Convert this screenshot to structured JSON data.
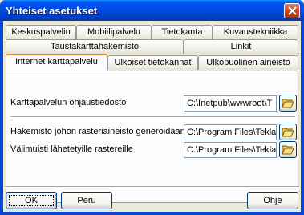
{
  "window": {
    "title": "Yhteiset asetukset",
    "close_icon": "close-icon"
  },
  "tabs": {
    "row1": [
      "Keskuspalvelin",
      "Mobiilipalvelu",
      "Tietokanta",
      "Kuvaustekniikka"
    ],
    "row2": [
      "Taustakarttahakemisto",
      "Linkit"
    ],
    "row3": [
      "Internet karttapalvelu",
      "Ulkoiset tietokannat",
      "Ulkopuolinen aineisto"
    ],
    "active": "Internet karttapalvelu"
  },
  "panel": {
    "field1": {
      "label": "Karttapalvelun ohjaustiedosto",
      "value": "C:\\Inetpub\\wwwroot\\T",
      "browse_icon": "open-folder-icon"
    },
    "field2": {
      "label": "Hakemisto johon rasteriaineisto generoidaan",
      "value": "C:\\Program Files\\Tekla",
      "browse_icon": "open-folder-icon"
    },
    "field3": {
      "label": "Välimuisti lähetetyille rastereille",
      "value": "C:\\Program Files\\Tekla",
      "browse_icon": "open-folder-icon"
    }
  },
  "buttons": {
    "ok": "OK",
    "cancel": "Peru",
    "help": "Ohje"
  }
}
